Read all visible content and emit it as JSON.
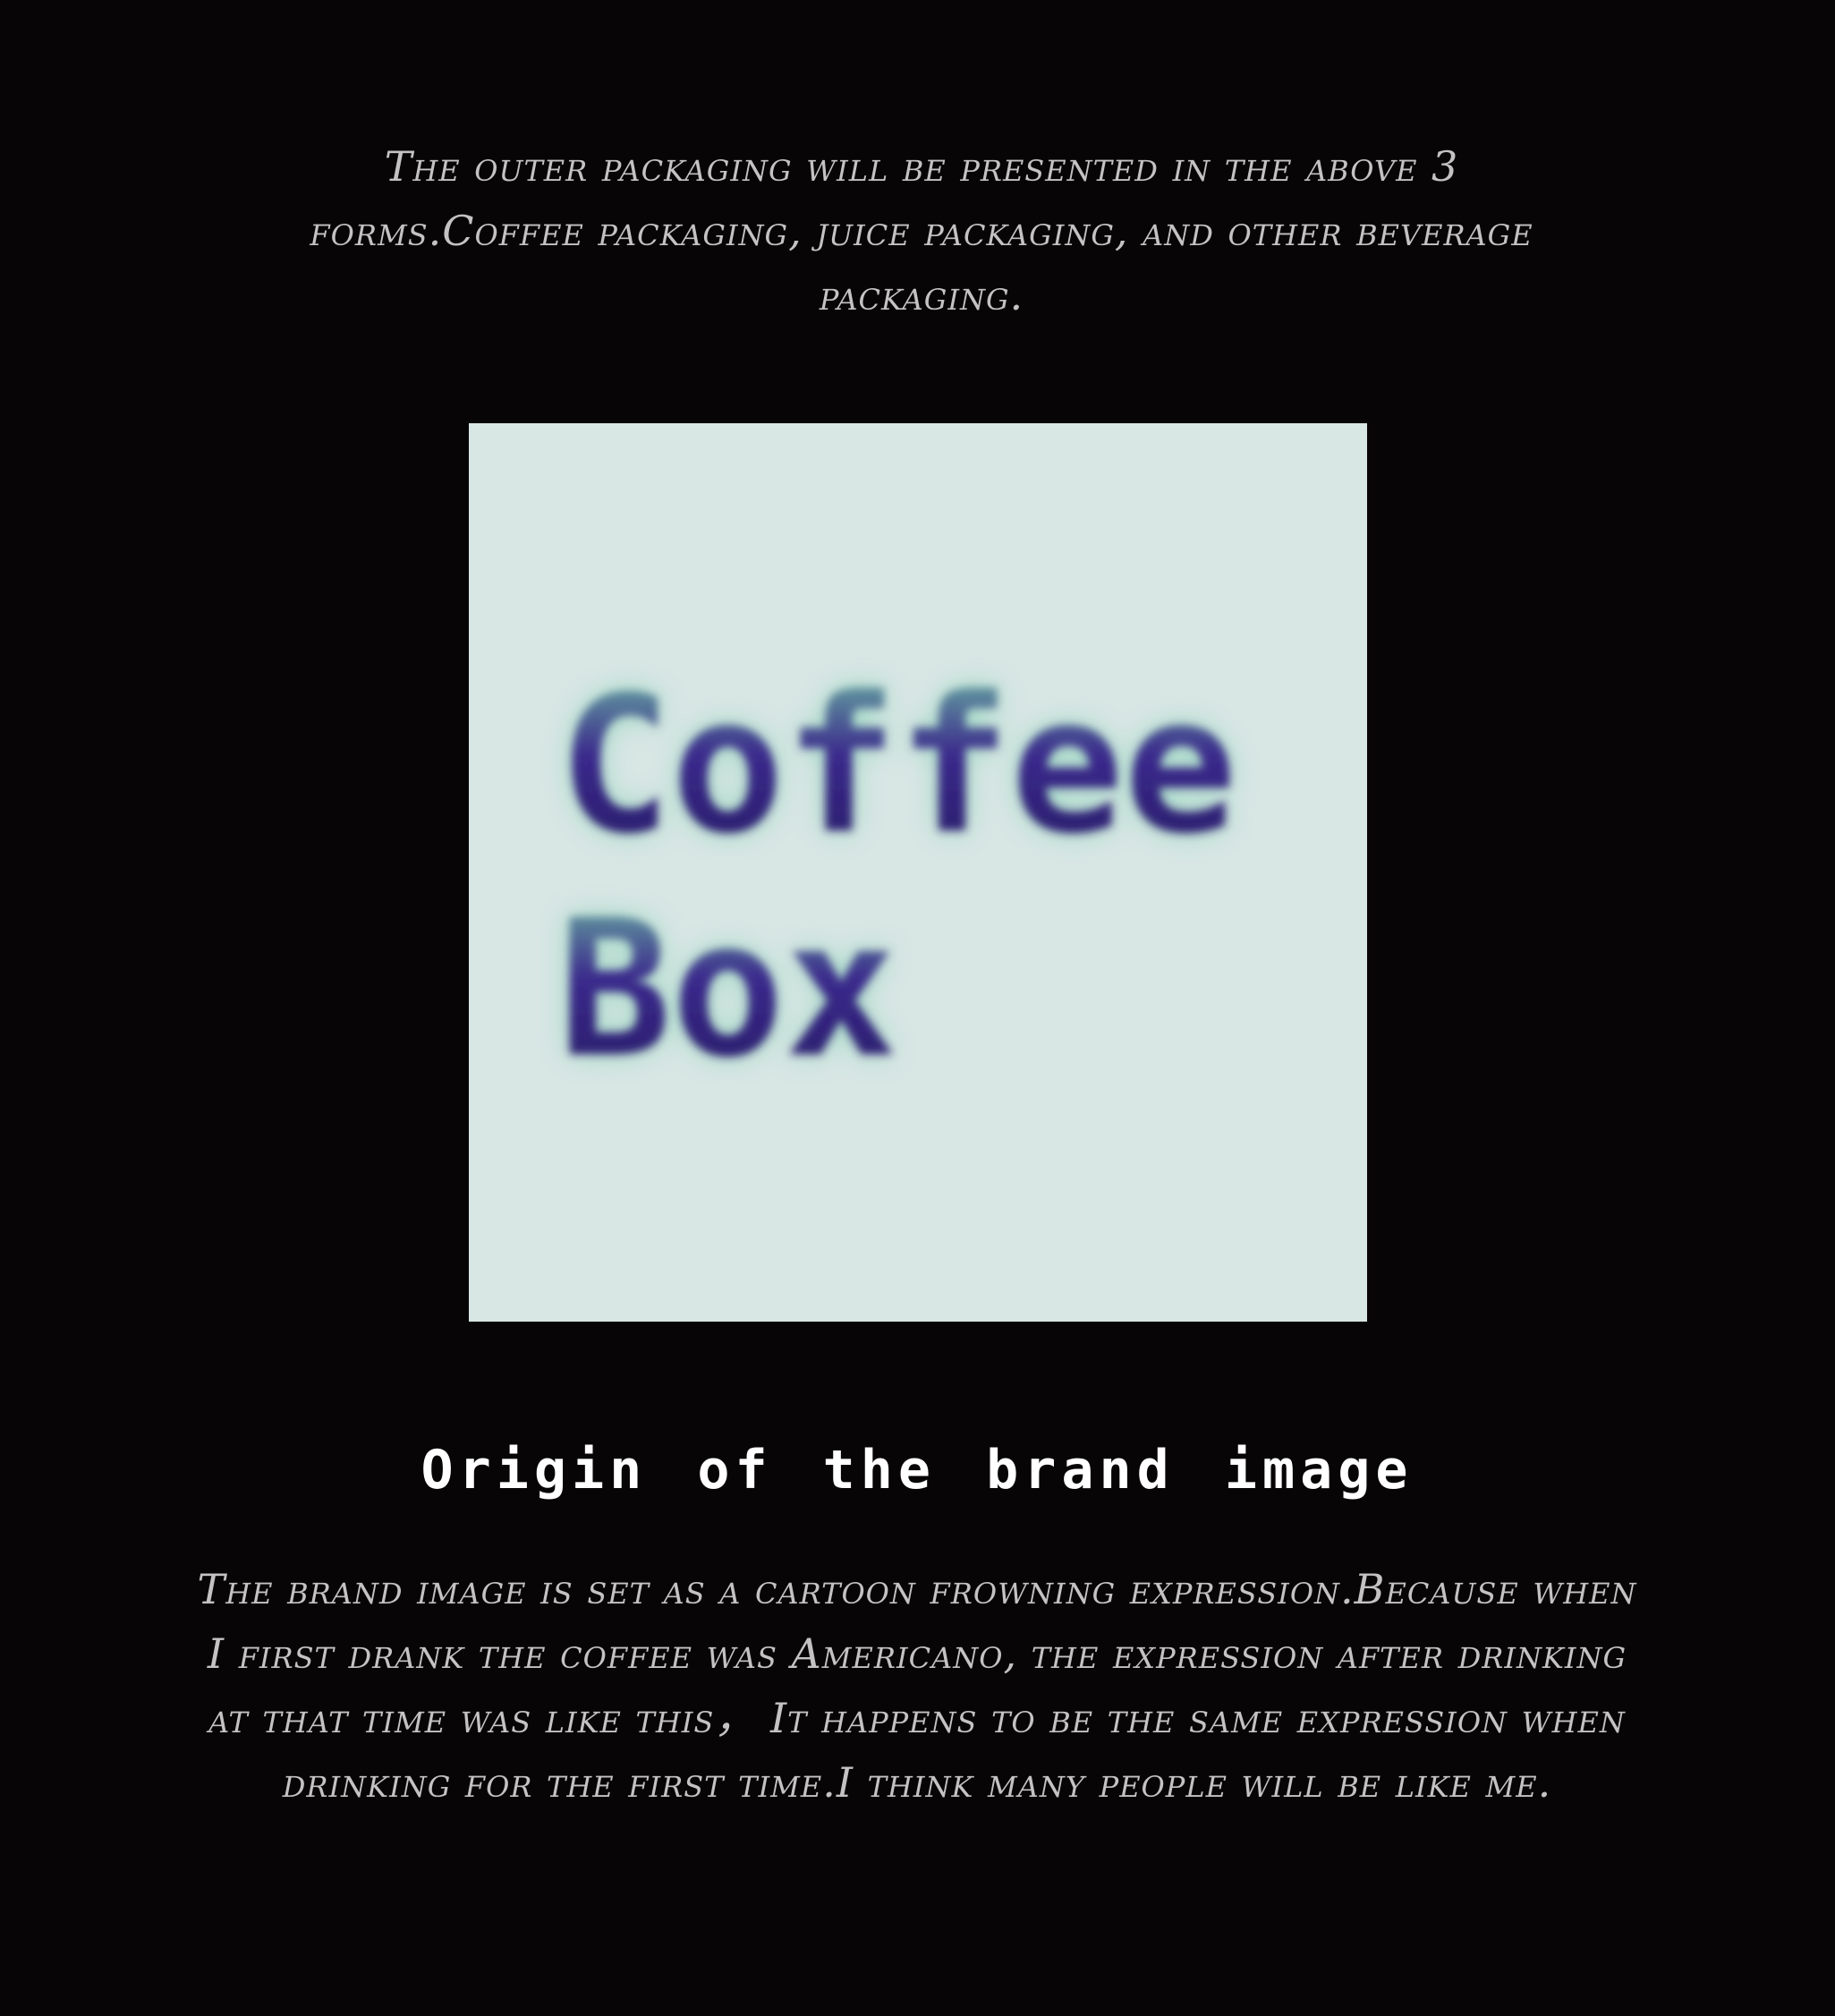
{
  "intro": {
    "text": "The outer packaging will be presented in the above 3 forms.Coffee packaging, juice packaging, and other beverage packaging."
  },
  "logo": {
    "line1": "Coffee",
    "line2": "Box",
    "background_color": "#d8e6e4",
    "ink_color": "#3b2a8c",
    "glow_color": "#7fcfb0"
  },
  "section": {
    "heading": "Origin of the brand image",
    "body": "The brand image is set as a cartoon frowning expression.Because when I first drank the coffee was Americano, the expression after drinking at that time was like this， It happens to be the same expression when drinking for the first time.I think many people will be like me."
  }
}
